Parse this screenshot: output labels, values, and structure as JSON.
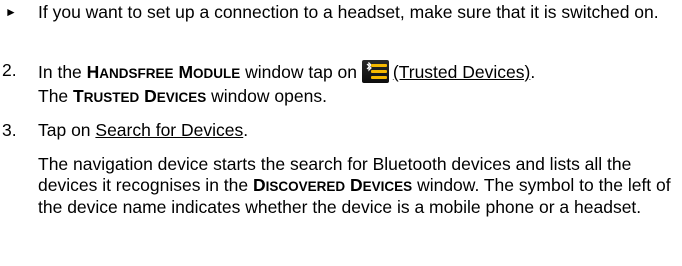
{
  "bullet_item": {
    "symbol": "►",
    "text": "If you want to set up a connection to a headset, make sure that it is switched on."
  },
  "step2": {
    "number": "2.",
    "prefix": "In the ",
    "window_name": "Handsfree Module",
    "mid": " window tap on ",
    "icon": "trusted-devices-icon",
    "link": "(Trusted Devices)",
    "suffix": ".",
    "result_window": "Trusted Devices",
    "result_suffix": " window opens.",
    "result_prefix": "The "
  },
  "step3": {
    "number": "3.",
    "prefix": "Tap on ",
    "link": "Search for Devices",
    "suffix": ".",
    "result_part1": "The navigation device starts the search for Bluetooth devices and lists all the devices it recognises in the ",
    "result_window": "Discovered Devices",
    "result_part2": " window. The symbol to the left of the device name indicates whether the device is a mobile phone or a headset."
  },
  "colors": {
    "icon_bar": "#f5b800",
    "icon_bg": "#1a1a1a"
  }
}
